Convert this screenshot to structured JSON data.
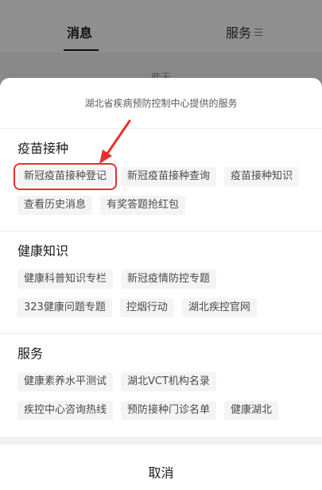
{
  "background": {
    "tabs": [
      {
        "label": "消息"
      },
      {
        "label": "服务"
      }
    ],
    "date_label": "昨天"
  },
  "sheet": {
    "header": "湖北省疾病预防控制中心提供的服务",
    "sections": [
      {
        "title": "疫苗接种",
        "items": [
          "新冠疫苗接种登记",
          "新冠疫苗接种查询",
          "疫苗接种知识",
          "查看历史消息",
          "有奖答题抢红包"
        ]
      },
      {
        "title": "健康知识",
        "items": [
          "健康科普知识专栏",
          "新冠疫情防控专题",
          "323健康问题专题",
          "控烟行动",
          "湖北疾控官网"
        ]
      },
      {
        "title": "服务",
        "items": [
          "健康素养水平测试",
          "湖北VCT机构名录",
          "疾控中心咨询热线",
          "预防接种门诊名单",
          "健康湖北"
        ]
      }
    ],
    "cancel_label": "取消"
  },
  "annotation_color": "#e5322d",
  "icons": {
    "menu": "menu-lines-icon",
    "arrow": "red-arrow-icon"
  }
}
